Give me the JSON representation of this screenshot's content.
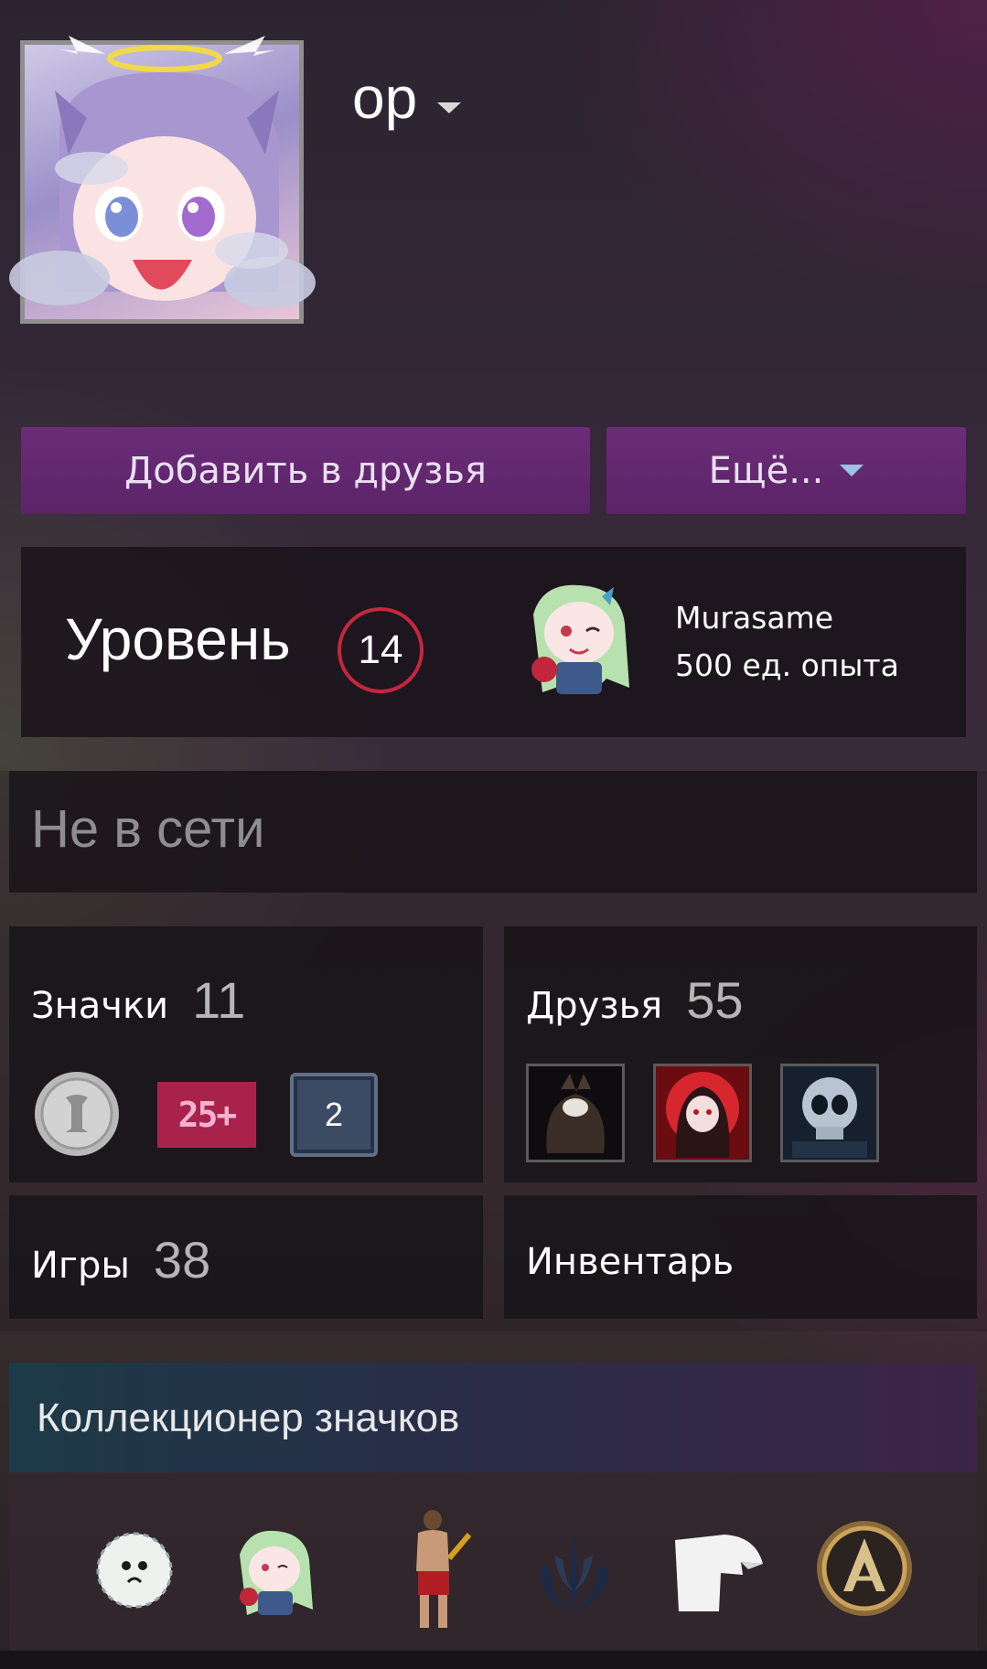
{
  "profile": {
    "username": "ор",
    "avatar": "avatar-anime-girl-halo"
  },
  "actions": {
    "add_friend": "Добавить в друзья",
    "more": "Ещё..."
  },
  "level": {
    "label": "Уровень",
    "value": "14",
    "favorite_badge": {
      "name": "Murasame",
      "xp": "500 ед. опыта"
    }
  },
  "status": {
    "text": "Не в сети"
  },
  "badges": {
    "label": "Значки",
    "count": "11",
    "items": [
      "silver-coin-badge",
      "25-plus-years-badge",
      "level-2-badge"
    ],
    "years_text": "25+",
    "level_text": "2"
  },
  "friends": {
    "label": "Друзья",
    "count": "55",
    "items": [
      "friend-avatar-dark-creature",
      "friend-avatar-red-hood",
      "friend-avatar-skull"
    ]
  },
  "games": {
    "label": "Игры",
    "count": "38"
  },
  "inventory": {
    "label": "Инвентарь"
  },
  "showcase": {
    "title": "Коллекционер значков",
    "badges": [
      "fluffy-ghost-badge",
      "murasame-badge",
      "warrior-badge",
      "jedi-order-badge",
      "eagle-badge",
      "laurel-emblem-badge"
    ]
  },
  "colors": {
    "button_purple": "#6b2c78",
    "level_ring": "#c7263e",
    "more_caret": "#9cc3e6"
  }
}
